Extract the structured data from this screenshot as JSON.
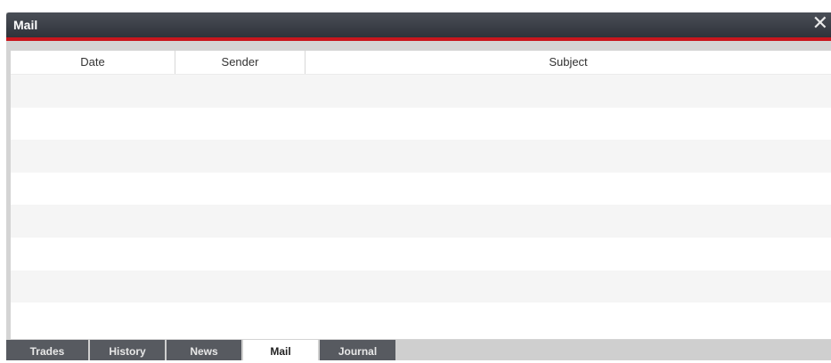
{
  "window": {
    "title": "Mail",
    "close_symbol": "✕",
    "accent_color": "#c8161d"
  },
  "table": {
    "columns": [
      "Date",
      "Sender",
      "Subject"
    ],
    "rows": []
  },
  "tabs": [
    {
      "label": "Trades",
      "active": false
    },
    {
      "label": "History",
      "active": false
    },
    {
      "label": "News",
      "active": false
    },
    {
      "label": "Mail",
      "active": true
    },
    {
      "label": "Journal",
      "active": false
    }
  ]
}
